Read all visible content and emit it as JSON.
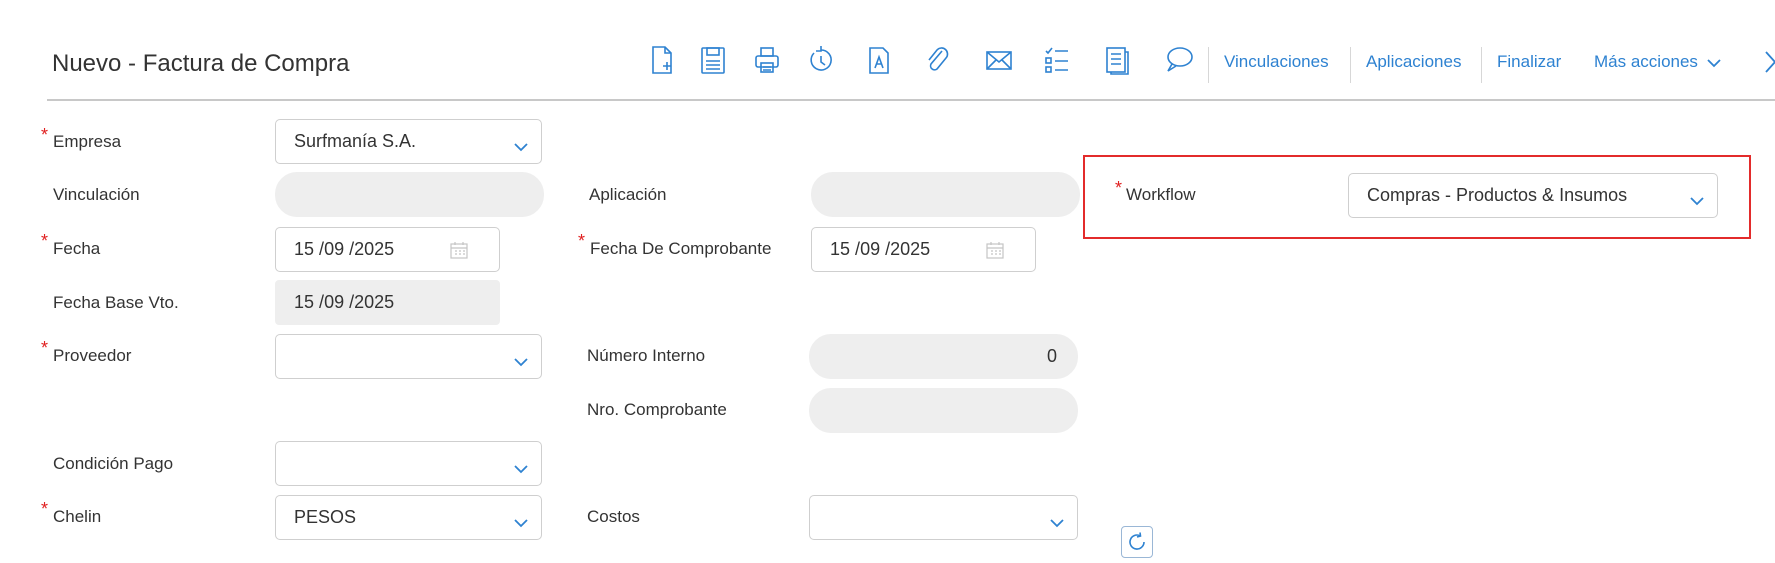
{
  "header": {
    "title": "Nuevo - Factura de Compra",
    "toolbar_icons": [
      "new-document-icon",
      "save-icon",
      "print-icon",
      "history-icon",
      "text-document-icon",
      "paperclip-icon",
      "envelope-icon",
      "checklist-icon",
      "report-icon",
      "comment-icon"
    ],
    "links": {
      "vinculaciones": "Vinculaciones",
      "aplicaciones": "Aplicaciones",
      "finalizar": "Finalizar",
      "mas_acciones": "Más acciones"
    }
  },
  "form": {
    "empresa": {
      "label": "Empresa",
      "value": "Surfmanía S.A.",
      "required": true
    },
    "vinculacion": {
      "label": "Vinculación",
      "value": ""
    },
    "aplicacion": {
      "label": "Aplicación",
      "value": ""
    },
    "workflow": {
      "label": "Workflow",
      "value": "Compras - Productos & Insumos",
      "required": true
    },
    "fecha": {
      "label": "Fecha",
      "day": "15",
      "month": "09",
      "year": "2025",
      "required": true
    },
    "fecha_comprobante": {
      "label": "Fecha De Comprobante",
      "day": "15",
      "month": "09",
      "year": "2025",
      "required": true
    },
    "fecha_base_vto": {
      "label": "Fecha Base Vto.",
      "day": "15",
      "month": "09",
      "year": "2025"
    },
    "proveedor": {
      "label": "Proveedor",
      "value": "",
      "required": true
    },
    "numero_interno": {
      "label": "Número Interno",
      "value": "0"
    },
    "nro_comprobante": {
      "label": "Nro. Comprobante",
      "value": ""
    },
    "condicion_pago": {
      "label": "Condición Pago",
      "value": ""
    },
    "chelin": {
      "label": "Chelin",
      "value": "PESOS",
      "required": true
    },
    "costos": {
      "label": "Costos",
      "value": ""
    }
  },
  "required_mark": "*",
  "date_separator": "/",
  "colors": {
    "link": "#2e82d1",
    "required": "#e02020",
    "highlight_border": "#e32b2b",
    "readonly_bg": "#eeeeee"
  }
}
